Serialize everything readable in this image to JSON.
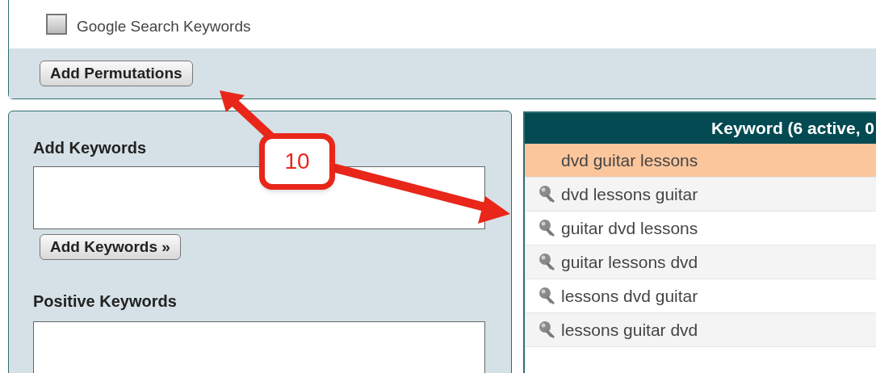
{
  "options": {
    "checkboxes": [
      {
        "label": "Google Search Keywords",
        "checked": false
      }
    ],
    "button": "Add Permutations"
  },
  "add_keywords": {
    "heading": "Add Keywords",
    "button": "Add Keywords »"
  },
  "positive_keywords": {
    "heading": "Positive Keywords"
  },
  "keyword_table": {
    "header": "Keyword (6 active, 0",
    "rows": [
      {
        "keyword": "dvd guitar lessons",
        "selected": true,
        "kind": "plain"
      },
      {
        "keyword": "dvd lessons guitar",
        "selected": false,
        "kind": "key"
      },
      {
        "keyword": "guitar dvd lessons",
        "selected": false,
        "kind": "key"
      },
      {
        "keyword": "guitar lessons dvd",
        "selected": false,
        "kind": "key"
      },
      {
        "keyword": "lessons dvd guitar",
        "selected": false,
        "kind": "key"
      },
      {
        "keyword": "lessons guitar dvd",
        "selected": false,
        "kind": "key"
      }
    ]
  },
  "annotation": {
    "label": "10"
  }
}
